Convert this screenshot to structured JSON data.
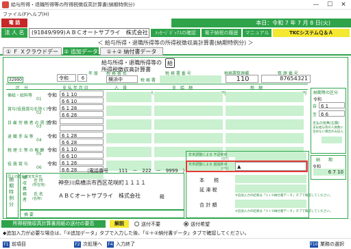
{
  "window": {
    "title": "給与所得・退職所得等の所得税徴収高計算書(納期特例分)",
    "minimize": "—",
    "maximize": "☐",
    "close": "✕"
  },
  "menu": {
    "file": "ファイル(F)",
    "help": "ヘルプ(H)"
  },
  "header": {
    "dentatsu": "電 話",
    "date": "本日：令和 7 年 7 月 8 日(火)",
    "corp_label": "法 人 名",
    "corp_name": "(91849/999)ＡＢＣオートサプライ　株式会社",
    "buttons": [
      "ﾒｯｾｰｼﾞﾎﾞｯｸｽの確認",
      "電子納税の履歴",
      "マニュアル",
      "TKCシステムＱ＆Ａ"
    ]
  },
  "page_heading": "＜ 給与所得・退職所得等の所得税徴収高計算書(納期特例分) ＞",
  "tabs": [
    "① Ｆ Ｘクラウドデータ",
    "② 追加データ",
    "①＋② 納付書データ"
  ],
  "form": {
    "form_code": "32990",
    "title_line1": "給与所得・退職所得等の",
    "title_line2": "所得税徴収高計算書",
    "stamp": "給",
    "era": "令和",
    "year": "6",
    "year_label": "年 度",
    "office_label": "税 務 署 名",
    "office_value": "横浜中",
    "office_suffix": "税 務 署",
    "office_no_label": "税 務 署 番 号",
    "usage_label": "税務署整理欄",
    "usage_value": "110",
    "seiri_label": "整 理 番 号",
    "seiri_value": "87654321",
    "col_kubun": "区　分",
    "col_shikyu": "支 払 年 月 日",
    "col_ninin": "人　員",
    "col_shikyu_gaku": "支　給　額",
    "col_zeigaku": "税　額",
    "unit_ninin": "人",
    "unit_yen": "円",
    "rows": [
      {
        "label": "俸給・給料等",
        "code": "01",
        "era": "令和",
        "d1": "6 1 10",
        "d2": "6 6 10"
      },
      {
        "label": "賞与(役員賞与を除く)",
        "code": "02",
        "era": "令和",
        "d1": "6 1 28",
        "d2": "6 6 28"
      },
      {
        "label": "日 雇 労 務 者 の 賃 金",
        "code": "03",
        "era": "令和",
        "d1": "",
        "d2": ""
      },
      {
        "label": "退 職 手 当 等",
        "code": "04",
        "era": "令和",
        "d1": "6 1 28",
        "d2": "6 6 28"
      },
      {
        "label": "税 理 士 等 の 報 酬",
        "code": "05",
        "era": "令和",
        "d1": "6 1 10",
        "d2": "6 6 10"
      },
      {
        "label": "役 員 賞 与",
        "code": "06",
        "era": "令和",
        "d1": "6 1 28",
        "d2": "6 6 28"
      },
      {
        "label": "同上の支払確定年月日",
        "code": "",
        "era": "",
        "d1": "",
        "d2": ""
      }
    ],
    "nouki_label": "納期等の区分",
    "nouki_era": "令和",
    "nouki_from": "6 1",
    "nouki_to": "6 6",
    "nouki_sep1": "自",
    "nouki_sep2": "至",
    "kankou_label": "支払の有無(左欄)",
    "kankou_note": "支払給与等の人員数に含めない場合のみ記入",
    "nouki2_label": "納　　期",
    "nouki2_era": "令和",
    "nouki2_value": "6 7 10",
    "phone_label": "（電話番号",
    "phone_value": "111　－　222　－　9999　）",
    "side_label": "納 期 特 例 分",
    "chou_label": "徴 収 義 務 者",
    "address_label": "住 所",
    "address_sub": "(所在地)",
    "address_value": "神奈川県横浜市西区花咲町１１１１",
    "name_label": "氏 名",
    "name_sub": "(名称)",
    "name_value": "ＡＢＣオートサプライ　株式会社",
    "dono": "殿",
    "tekiyo_label": "摘 要",
    "adj1_label": "年末調整による 不足税額",
    "adj1_code": "(07)",
    "adj2_label": "年末調整による 超過税額",
    "adj2_code": "(05)",
    "adj2_value": "▲",
    "honzei_label": "本　　税",
    "entai_label": "延 滞 税",
    "gokei_label": "合 計 額",
    "note1": "※追加入力の結果は「①＋②納付書データ」タブで確認してください。",
    "note2": "※追加入力の結果は「①＋②納付書データ」タブで確認してください。"
  },
  "footer": {
    "send_label": "所得税徴収高計算書用紙の送付の要否",
    "explain": "解説",
    "opt_no": "送付不要",
    "opt_yes": "送付希望",
    "selected": "送付希望",
    "notice": "◆追加入力が必要な場合は、「②追加データ」タブで入力した後、「①＋②納付書データ」タブで確認してください。",
    "fkeys": [
      {
        "key": "F1",
        "label": "前項目"
      },
      {
        "key": "F2",
        "label": "次処理へ"
      },
      {
        "key": "F4",
        "label": "入力終了"
      },
      {
        "key": "F10",
        "label": "業務の選択"
      }
    ]
  },
  "colors": {
    "accent": "#2ea34a",
    "light_green": "#c9f0cf",
    "alert_red": "#e53935",
    "badge_red": "#c62828",
    "yellow": "#f4e830"
  }
}
